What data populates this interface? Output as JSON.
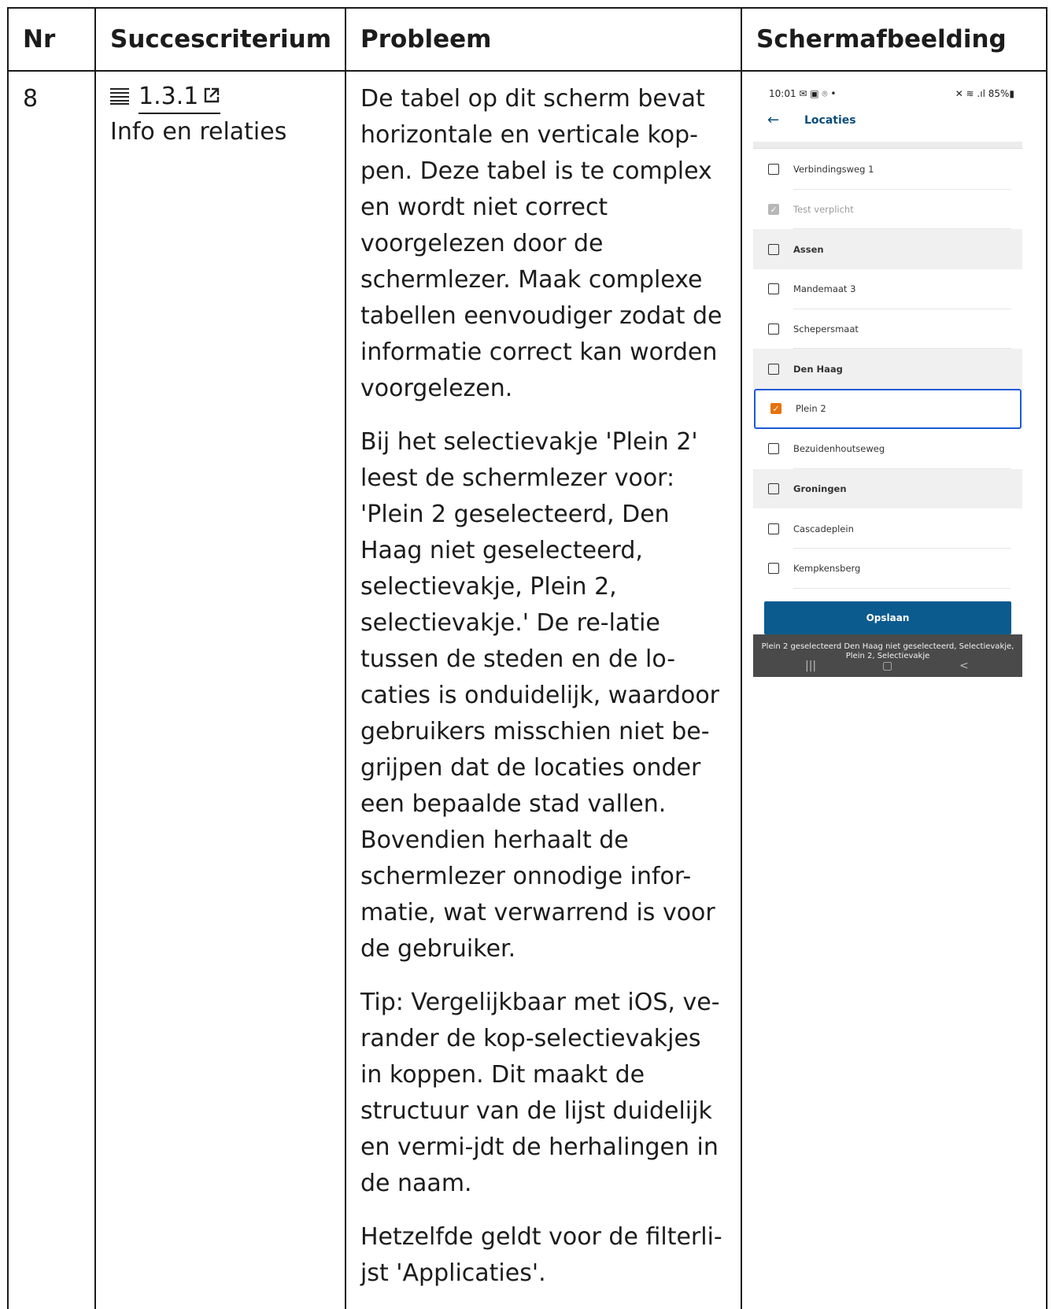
{
  "table": {
    "headers": [
      "Nr",
      "Succescriterium",
      "Probleem",
      "Schermafbeelding"
    ],
    "row": {
      "nr": "8",
      "criterion_number": "1.3.1",
      "criterion_name": "Info en relaties",
      "problem_paragraphs": [
        "De tabel op dit scherm bevat horizontale en verticale kop-pen. Deze tabel is te complex en wordt niet correct voorgelezen door de schermlezer. Maak complexe tabellen eenvoudiger zodat de informatie correct kan worden voorgelezen.",
        "Bij het selectievakje 'Plein 2' leest de schermlezer voor: 'Plein 2 geselecteerd, Den Haag niet geselecteerd, selectievakje, Plein 2, selectievakje.' De re-latie tussen de steden en de lo-caties is onduidelijk, waardoor gebruikers misschien niet be-grijpen dat de locaties onder een bepaalde stad vallen. Bovendien herhaalt de schermlezer onnodige infor-matie, wat verwarrend is voor de gebruiker.",
        "Tip: Vergelijkbaar met iOS, ve-rander de kop-selectievakjes in koppen. Dit maakt de structuur van de lijst duidelijk en vermi-jdt de herhalingen in de naam.",
        "Hetzelfde geldt voor de filterli-jst 'Applicaties'."
      ]
    }
  },
  "phone": {
    "status_time": "10:01 ✉ ▣ ⌾ •",
    "status_right": "✕ ≋ .ıl 85%▮",
    "title": "Locaties",
    "items": [
      {
        "label": "Verbindingsweg 1",
        "group": false,
        "state": "unchecked"
      },
      {
        "label": "Test verplicht",
        "group": false,
        "state": "disabled"
      },
      {
        "label": "Assen",
        "group": true,
        "state": "unchecked"
      },
      {
        "label": "Mandemaat 3",
        "group": false,
        "state": "unchecked"
      },
      {
        "label": "Schepersmaat",
        "group": false,
        "state": "unchecked"
      },
      {
        "label": "Den Haag",
        "group": true,
        "state": "unchecked"
      },
      {
        "label": "Plein 2",
        "group": false,
        "state": "checked",
        "focused": true
      },
      {
        "label": "Bezuidenhoutseweg",
        "group": false,
        "state": "unchecked"
      },
      {
        "label": "Groningen",
        "group": true,
        "state": "unchecked"
      },
      {
        "label": "Cascadeplein",
        "group": false,
        "state": "unchecked"
      },
      {
        "label": "Kempkensberg",
        "group": false,
        "state": "unchecked"
      }
    ],
    "save_label": "Opslaan",
    "toast_text": "Plein 2 geselecteerd Den Haag niet geselecteerd, Selectievakje, Plein 2, Selectievakje",
    "accent_color": "#e8720c",
    "focus_color": "#1a5bd6",
    "button_color": "#0b5b8f"
  },
  "icons": {
    "list": "list-icon",
    "external": "external-link-icon",
    "back": "arrow-left-icon",
    "check": "checkmark-icon"
  }
}
